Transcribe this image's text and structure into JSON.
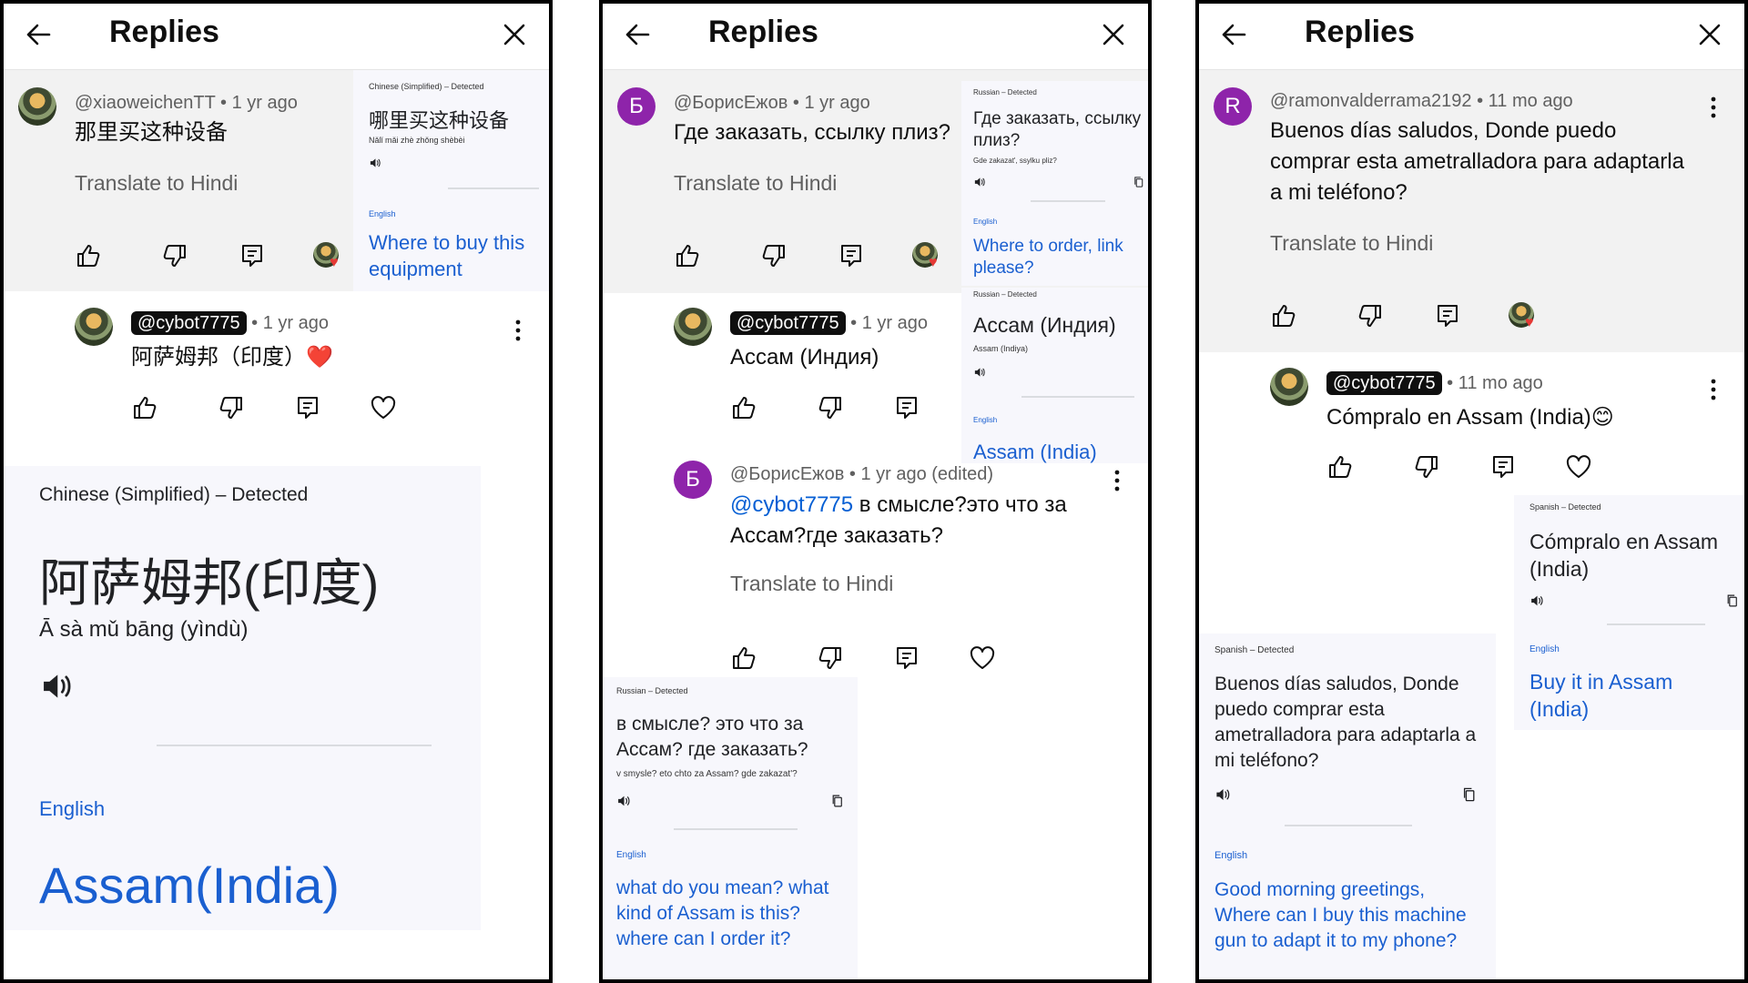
{
  "header": {
    "title": "Replies"
  },
  "panels": [
    {
      "parent": {
        "author": "@xiaoweichenTT",
        "time": "1 yr ago",
        "text": "那里买这种设备",
        "translate": "Translate to Hindi"
      },
      "popup_small": {
        "detected": "Chinese (Simplified) – Detected",
        "source": "哪里买这种设备",
        "romanized": "Nǎlǐ mǎi zhè zhǒng shèbèi",
        "target_label": "English",
        "translation": "Where to buy this equipment"
      },
      "reply": {
        "author": "@cybot7775",
        "time": "1 yr ago",
        "text": "阿萨姆邦（印度）❤️"
      },
      "popup_big": {
        "detected": "Chinese (Simplified) – Detected",
        "source": "阿萨姆邦(印度)",
        "romanized": "Ā sà mǔ bāng (yìndù)",
        "target_label": "English",
        "translation": "Assam(India)"
      }
    },
    {
      "parent": {
        "avatar_letter": "Б",
        "author": "@БорисЕжов",
        "time": "1 yr ago",
        "text": "Где заказать, ссылку плиз?",
        "translate": "Translate to Hindi"
      },
      "popup_top": {
        "detected": "Russian – Detected",
        "source": "Где заказать, ссылку плиз?",
        "romanized": "Gde zakazat', ssylku pliz?",
        "target_label": "English",
        "translation": "Where to order, link please?"
      },
      "reply": {
        "author": "@cybot7775",
        "time": "1 yr ago",
        "text": "Ассам (Индия)"
      },
      "popup_mid": {
        "detected": "Russian – Detected",
        "source": "Ассам (Индия)",
        "romanized": "Assam (Indiya)",
        "target_label": "English",
        "translation": "Assam (India)"
      },
      "reply2": {
        "avatar_letter": "Б",
        "author": "@БорисЕжов",
        "time": "1 yr ago (edited)",
        "mention": "@cybot7775",
        "text": "в смысле?это что за Ассам?где заказать?",
        "translate": "Translate to Hindi"
      },
      "popup_bottom": {
        "detected": "Russian – Detected",
        "source": "в смысле? это что за Ассам? где заказать?",
        "romanized": "v smysle? eto chto za Assam? gde zakazat'?",
        "target_label": "English",
        "translation": "what do you mean? what kind of Assam is this? where can I order it?"
      }
    },
    {
      "parent": {
        "avatar_letter": "R",
        "author": "@ramonvalderrama2192",
        "time": "11 mo ago",
        "text": "Buenos días saludos, Donde puedo comprar esta ametralladora para adaptarla a mi teléfono?",
        "translate": "Translate to Hindi"
      },
      "reply": {
        "author": "@cybot7775",
        "time": "11 mo ago",
        "text": "Cómpralo en Assam (India)😊"
      },
      "popup_right": {
        "detected": "Spanish – Detected",
        "source": "Cómpralo en Assam (India)",
        "target_label": "English",
        "translation": "Buy it in Assam (India)"
      },
      "popup_left": {
        "detected": "Spanish – Detected",
        "source": "Buenos días saludos, Donde puedo comprar esta ametralladora para adaptarla a mi teléfono?",
        "target_label": "English",
        "translation": "Good morning greetings, Where can I buy this machine gun to adapt it to my phone?"
      }
    }
  ]
}
